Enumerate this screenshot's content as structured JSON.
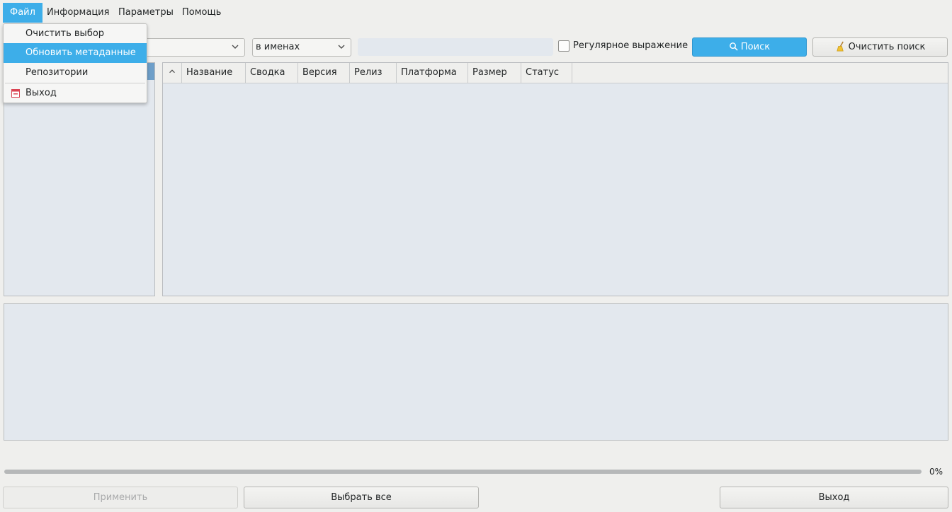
{
  "menubar": {
    "items": [
      {
        "label": "Файл",
        "active": true
      },
      {
        "label": "Информация"
      },
      {
        "label": "Параметры"
      },
      {
        "label": "Помощь"
      }
    ]
  },
  "file_menu": {
    "items": [
      {
        "label": "Очистить выбор"
      },
      {
        "label": "Обновить метаданные",
        "highlighted": true
      },
      {
        "label": "Репозитории"
      },
      {
        "label": "Выход",
        "icon": "exit-icon"
      }
    ]
  },
  "toolbar": {
    "category_combo_value": "",
    "search_scope_value": "в именах",
    "search_input_value": "",
    "regex_label": "Регулярное выражение",
    "regex_checked": false,
    "search_button_label": "Поиск",
    "clear_search_label": "Очистить поиск"
  },
  "package_table": {
    "columns": [
      "Название",
      "Сводка",
      "Версия",
      "Релиз",
      "Платформа",
      "Размер",
      "Статус"
    ],
    "rows": []
  },
  "progress": {
    "value_percent": 0,
    "label": "0%"
  },
  "footer": {
    "apply_label": "Применить",
    "select_all_label": "Выбрать все",
    "exit_label": "Выход"
  },
  "colors": {
    "accent": "#3daee9",
    "panel_bg": "#e3e8ee",
    "window_bg": "#efefed"
  }
}
